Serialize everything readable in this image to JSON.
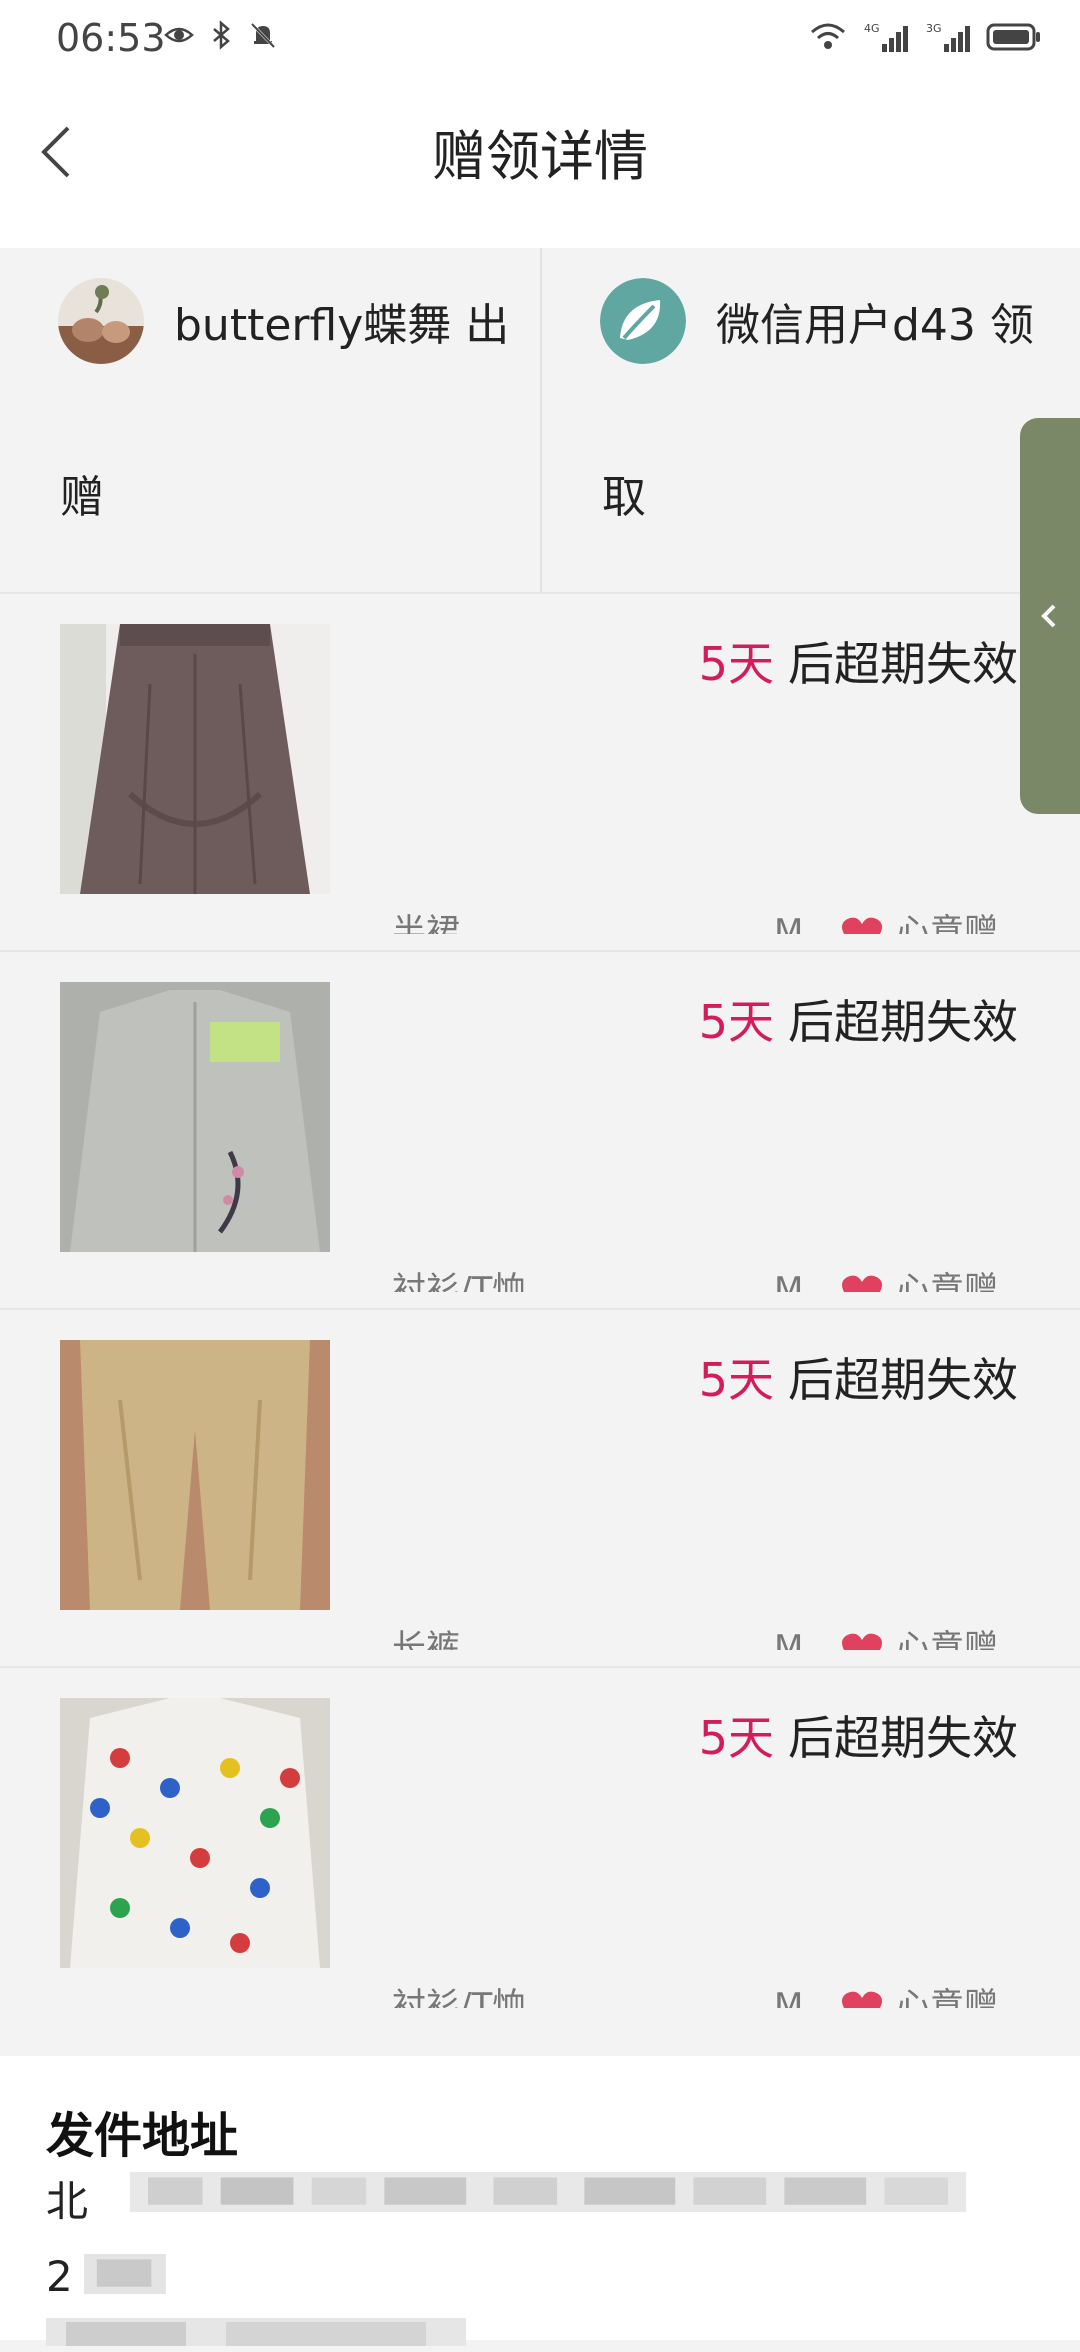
{
  "status_bar": {
    "time": "06:53",
    "left_icons": [
      "eye-icon",
      "bluetooth-icon",
      "bell-muted-icon"
    ],
    "right_icons": [
      "wifi-icon",
      "signal-4g-icon",
      "signal-3g-icon",
      "battery-icon"
    ],
    "network_labels": [
      "4G",
      "3G"
    ]
  },
  "header": {
    "title": "赠领详情",
    "back_icon": "chevron-left-icon"
  },
  "users": {
    "giver": {
      "name": "butterfly蝶舞",
      "role": "出赠",
      "role_line1": "出",
      "role_line2": "赠"
    },
    "receiver": {
      "name": "微信用户d43",
      "role": "领取",
      "role_line1": "领",
      "role_line2": "取"
    }
  },
  "items": [
    {
      "days": "5天",
      "expiry_suffix": "后超期失效",
      "name": "半裙",
      "size": "M",
      "note": "心意赠"
    },
    {
      "days": "5天",
      "expiry_suffix": "后超期失效",
      "name": "衬衫/T恤",
      "size": "M",
      "note": "心意赠"
    },
    {
      "days": "5天",
      "expiry_suffix": "后超期失效",
      "name": "长裤",
      "size": "M",
      "note": "心意赠"
    },
    {
      "days": "5天",
      "expiry_suffix": "后超期失效",
      "name": "衬衫/T恤",
      "size": "M",
      "note": "心意赠"
    }
  ],
  "address": {
    "title": "发件地址",
    "line1_start": "北",
    "line2_start": "2",
    "line3_start": ""
  },
  "colors": {
    "accent": "#d21d58",
    "heart": "#e0415f",
    "side_tab": "#7a8868"
  }
}
